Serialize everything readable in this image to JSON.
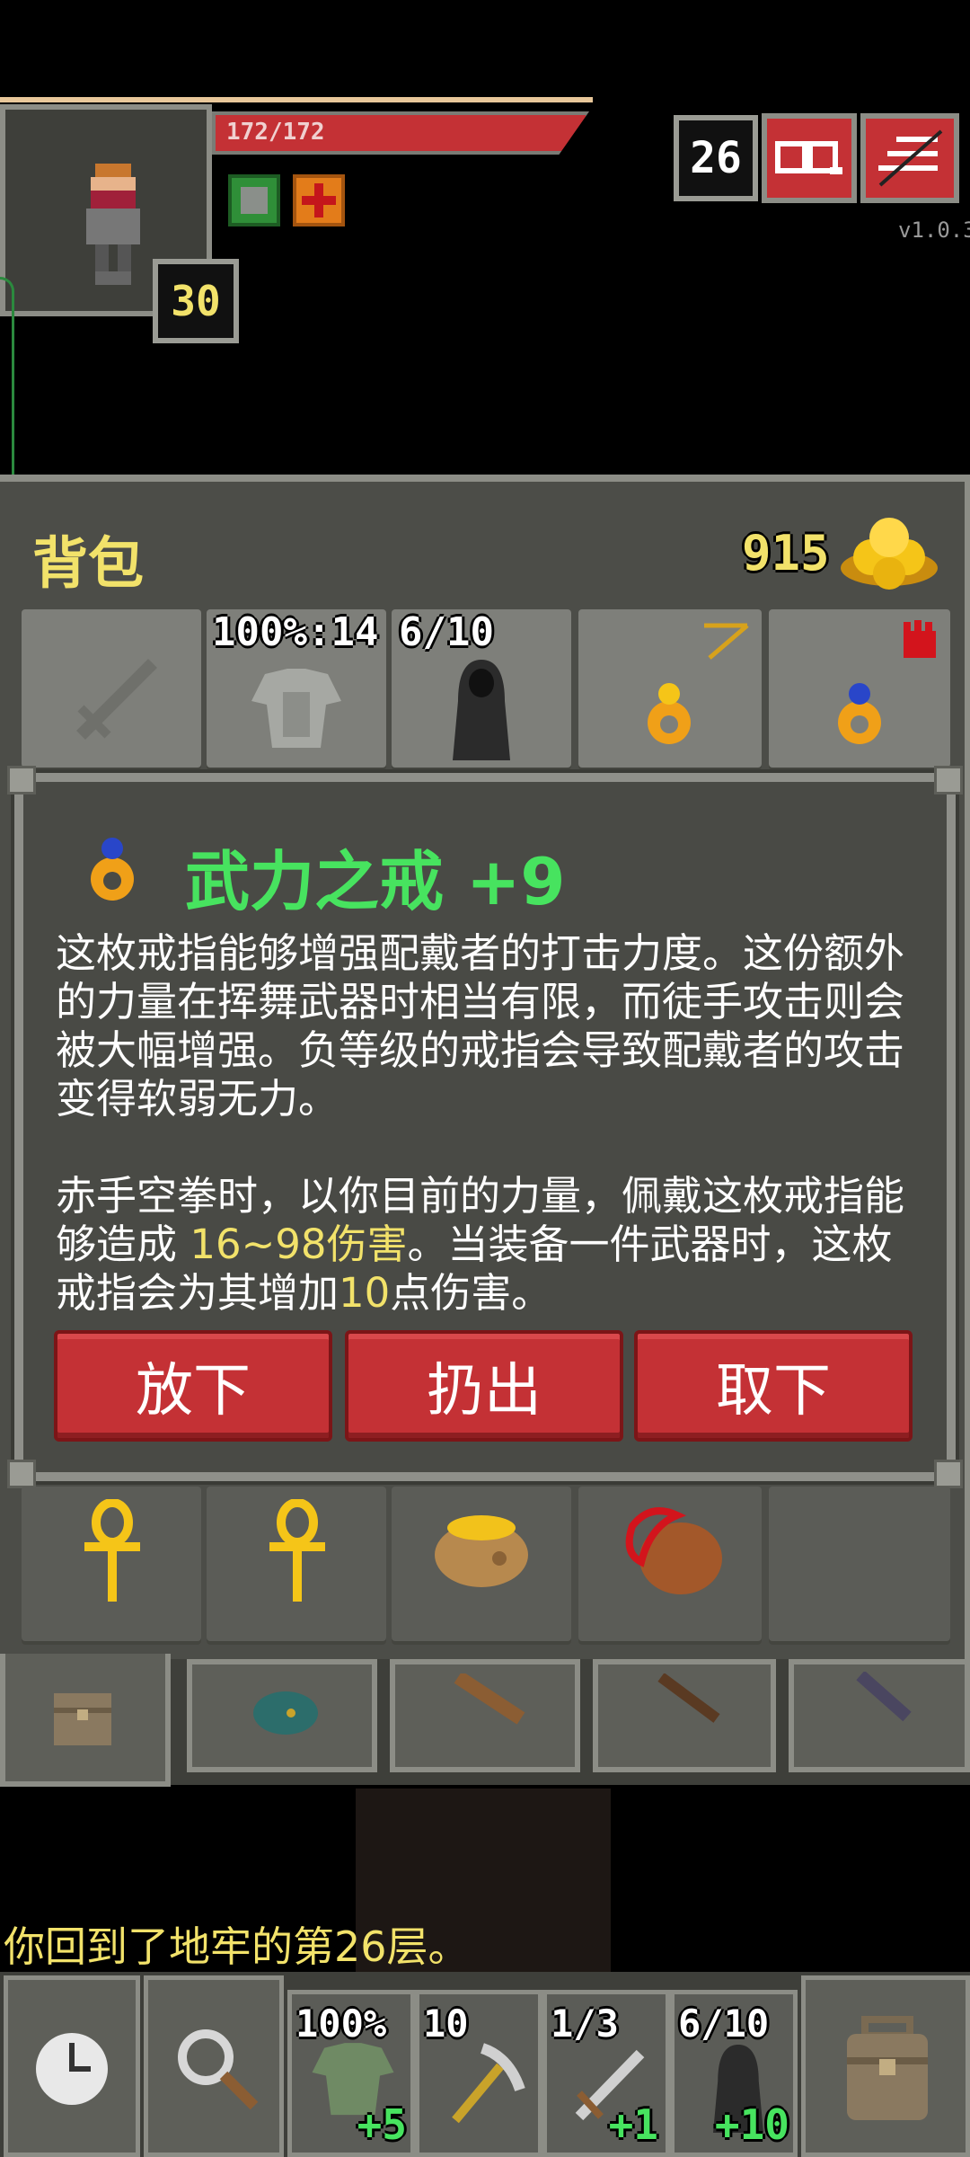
{
  "hud": {
    "hp_text": "172/172",
    "level": "30",
    "depth": "26",
    "version": "v1.0.3"
  },
  "backpack": {
    "title": "背包",
    "gold": "915",
    "top_row_labels": [
      "100%:14",
      "6/10"
    ]
  },
  "item_dialog": {
    "title": "武力之戒 +9",
    "desc_p1": "这枚戒指能够增强配戴者的打击力度。这份额外的力量在挥舞武器时相当有限，而徒手攻击则会被大幅增强。负等级的戒指会导致配戴者的攻击变得软弱无力。",
    "desc_p2_a": "赤手空拳时，以你目前的力量，佩戴这枚戒指能够造成 ",
    "desc_p2_hl1": "16~98伤害",
    "desc_p2_b": "。当装备一件武器时，这枚戒指会为其增加",
    "desc_p2_hl2": "10",
    "desc_p2_c": "点伤害。",
    "buttons": [
      "放下",
      "扔出",
      "取下"
    ]
  },
  "message": "你回到了地牢的第26层。",
  "quickbar": [
    {
      "top": "100%",
      "bottom": "+5"
    },
    {
      "top": "10",
      "bottom": ""
    },
    {
      "top": "1/3",
      "bottom": "+1"
    },
    {
      "top": "6/10",
      "bottom": "+10"
    }
  ],
  "colors": {
    "hp_red": "#c43135",
    "title_green": "#47e35f",
    "highlight_yellow": "#f2e26a",
    "gold": "#f5c518"
  }
}
